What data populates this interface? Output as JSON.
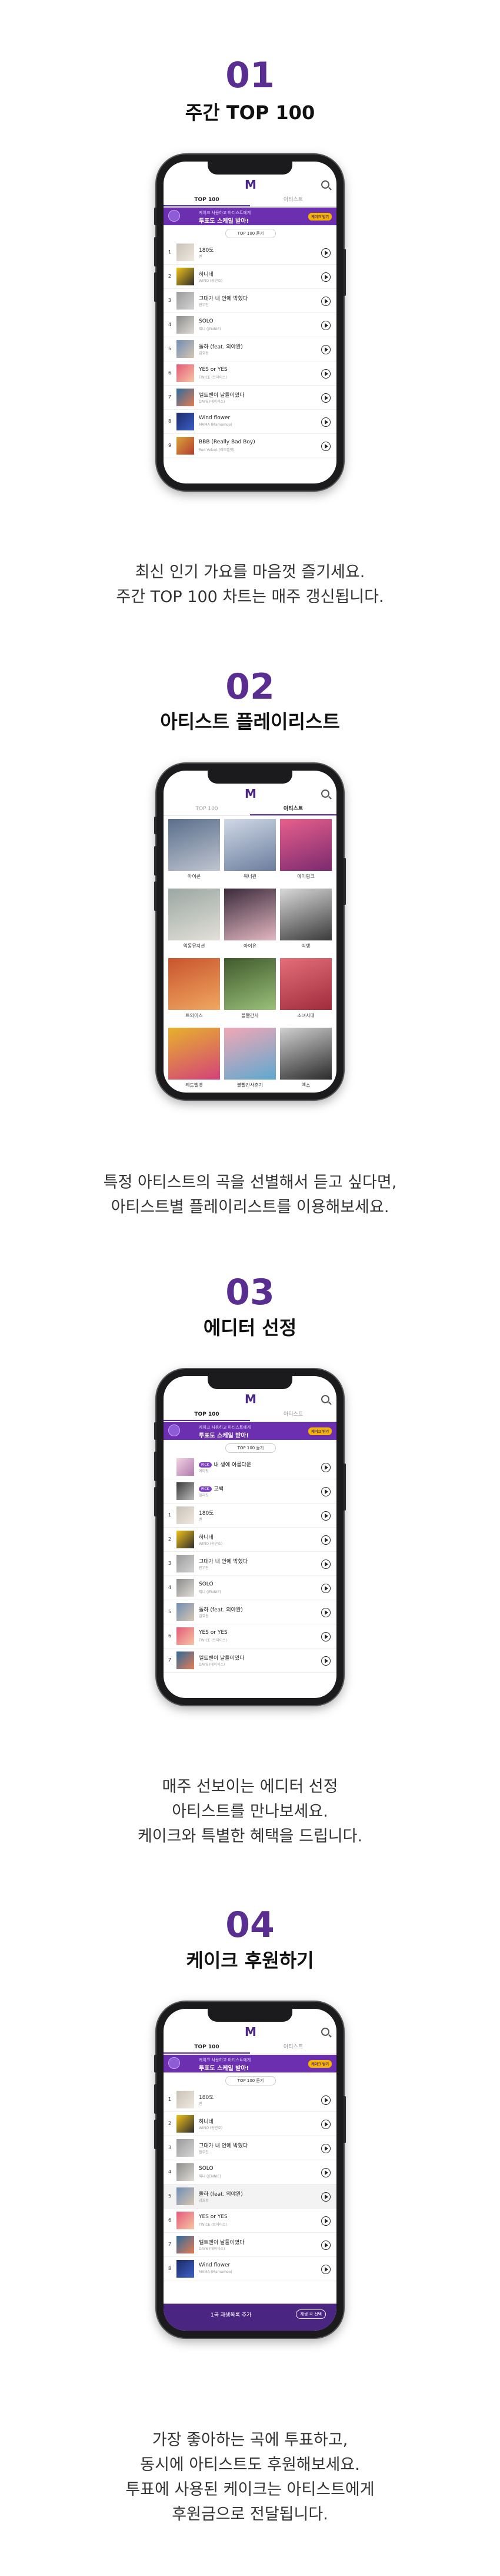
{
  "sections": [
    {
      "number": "01",
      "title": "주간 TOP 100",
      "desc": [
        "최신 인기 가요를 마음껏 즐기세요.",
        "주간 TOP 100 차트는 매주 갱신됩니다."
      ]
    },
    {
      "number": "02",
      "title": "아티스트 플레이리스트",
      "desc": [
        "특정 아티스트의 곡을 선별해서 듣고 싶다면,",
        "아티스트별 플레이리스트를 이용해보세요."
      ]
    },
    {
      "number": "03",
      "title": "에디터 선정",
      "desc": [
        "매주 선보이는 에디터 선정",
        "아티스트를 만나보세요.",
        "케이크와 특별한 혜택을 드립니다."
      ]
    },
    {
      "number": "04",
      "title": "케이크 후원하기",
      "desc": [
        "가장 좋아하는 곡에 투표하고,",
        "동시에 아티스트도 후원해보세요.",
        "투표에 사용된 케이크는 아티스트에게",
        "후원금으로 전달됩니다."
      ]
    }
  ],
  "app": {
    "logo": "M",
    "tab_top": "TOP 100",
    "tab_artist": "아티스트",
    "banner_small": "케이크 사용하고 아티스트에게",
    "banner_big": "투표도 스케일 받아!",
    "banner_btn": "케이크 받기",
    "top_pill": "TOP 100 듣기",
    "vote_text": "1곡 재생목록 추가",
    "vote_btn": "재생 곡 선택"
  },
  "songs": [
    {
      "rank": "1",
      "title": "180도",
      "artist": "벤"
    },
    {
      "rank": "2",
      "title": "하니네",
      "artist": "WINO (송민호)"
    },
    {
      "rank": "3",
      "title": "그대가 내 안에 박혔다",
      "artist": "원우진"
    },
    {
      "rank": "4",
      "title": "SOLO",
      "artist": "제니 (JENNIE)"
    },
    {
      "rank": "5",
      "title": "돌하 (feat. 의야완)",
      "artist": "김효동"
    },
    {
      "rank": "6",
      "title": "YES or YES",
      "artist": "TWICE (트와이스)"
    },
    {
      "rank": "7",
      "title": "멜트벤이 날들이였다",
      "artist": "DAY6 (데이식스)"
    },
    {
      "rank": "8",
      "title": "Wind flower",
      "artist": "MAMA (Mamamoo)"
    },
    {
      "rank": "9",
      "title": "BBB (Really Bad Boy)",
      "artist": "Red Velvet (레드벨벳)"
    }
  ],
  "editor_picks": [
    {
      "badge": "PICK",
      "title": "내 생에 아름다운",
      "artist": "에이핑"
    },
    {
      "badge": "PICK",
      "title": "고백",
      "artist": "델리킷"
    }
  ],
  "artists": [
    {
      "name": "아이콘"
    },
    {
      "name": "워너원"
    },
    {
      "name": "에이핑크"
    },
    {
      "name": "악동뮤지션"
    },
    {
      "name": "아이유"
    },
    {
      "name": "빅뱅"
    },
    {
      "name": "트와이스"
    },
    {
      "name": "볼빨간사"
    },
    {
      "name": "소녀시대"
    },
    {
      "name": "레드벨벳"
    },
    {
      "name": "볼빨간사춘기"
    },
    {
      "name": "엑소"
    }
  ]
}
